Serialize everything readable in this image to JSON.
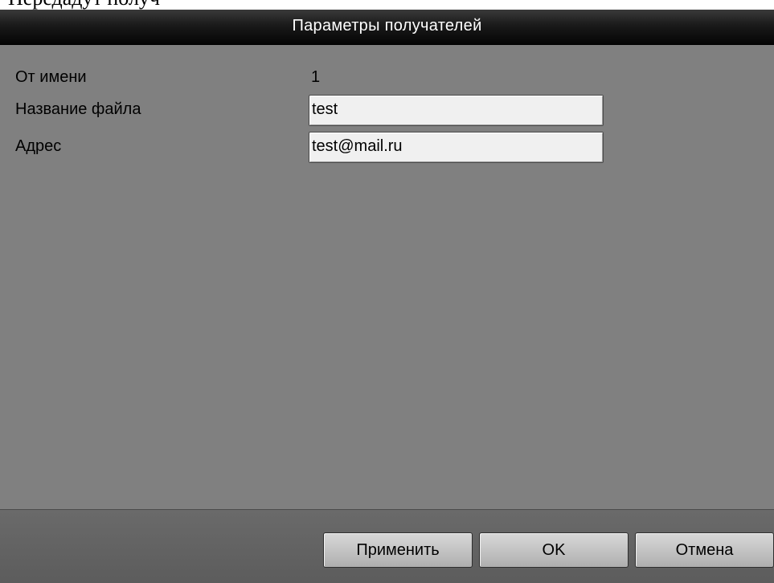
{
  "document_fragment": "Передадут получ",
  "dialog": {
    "title": "Параметры получателей"
  },
  "form": {
    "sender_label": "От имени",
    "sender_value": "1",
    "filename_label": "Название файла",
    "filename_value": "test",
    "address_label": "Адрес",
    "address_value": "test@mail.ru"
  },
  "buttons": {
    "apply": "Применить",
    "ok": "OK",
    "cancel": "Отмена"
  },
  "colors": {
    "dialog_background": "#808080",
    "titlebar": "#1a1a1a",
    "footer": "#5c5c5c",
    "field_background": "#f0f0f0"
  }
}
